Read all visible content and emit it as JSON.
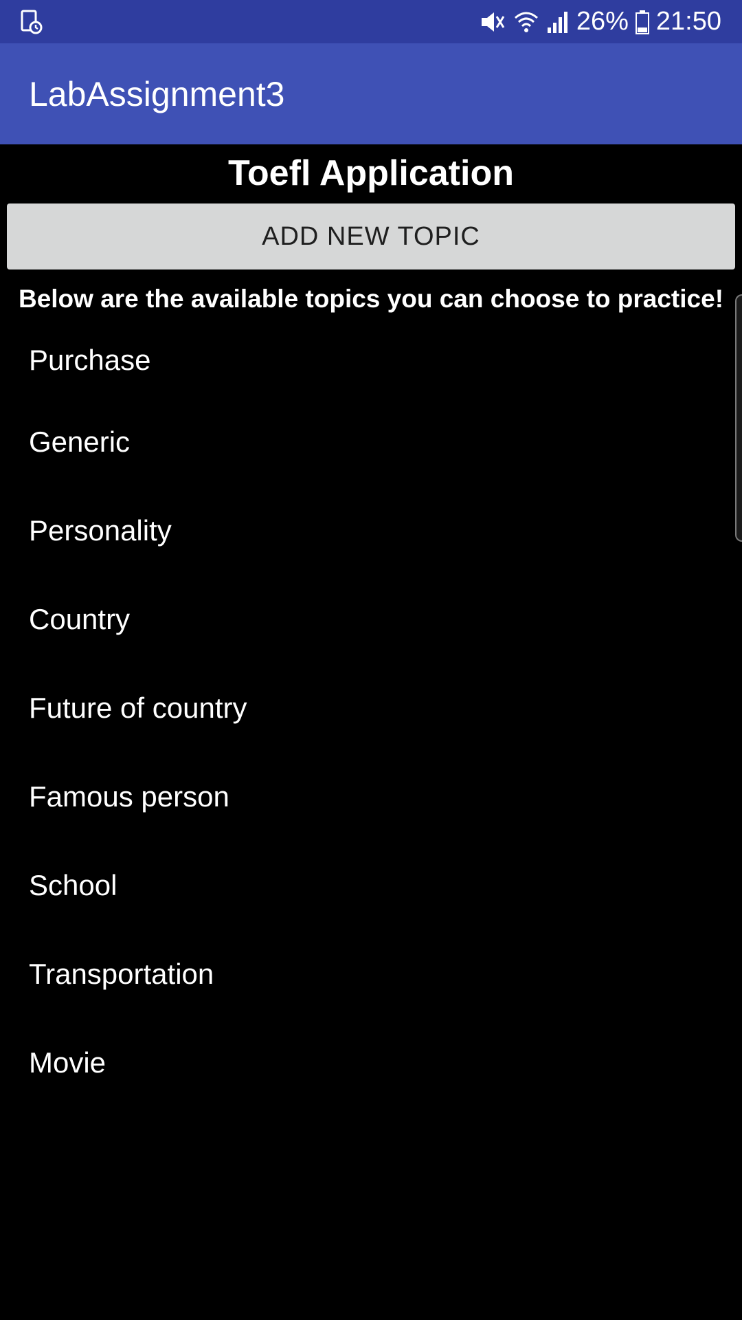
{
  "status_bar": {
    "battery_percent": "26%",
    "time": "21:50",
    "icons": [
      "screenshot-notification-icon",
      "mute-icon",
      "wifi-icon",
      "signal-icon",
      "battery-icon"
    ]
  },
  "app_bar": {
    "title": "LabAssignment3",
    "background_color": "#3f51b5",
    "status_bar_color": "#2f3d9f"
  },
  "main": {
    "heading": "Toefl Application",
    "add_button_label": "ADD NEW TOPIC",
    "subheading": "Below are the available topics you can choose to practice!",
    "topics": [
      "Purchase",
      "Generic",
      "Personality",
      "Country",
      "Future of country",
      "Famous person",
      "School",
      "Transportation",
      "Movie"
    ]
  }
}
